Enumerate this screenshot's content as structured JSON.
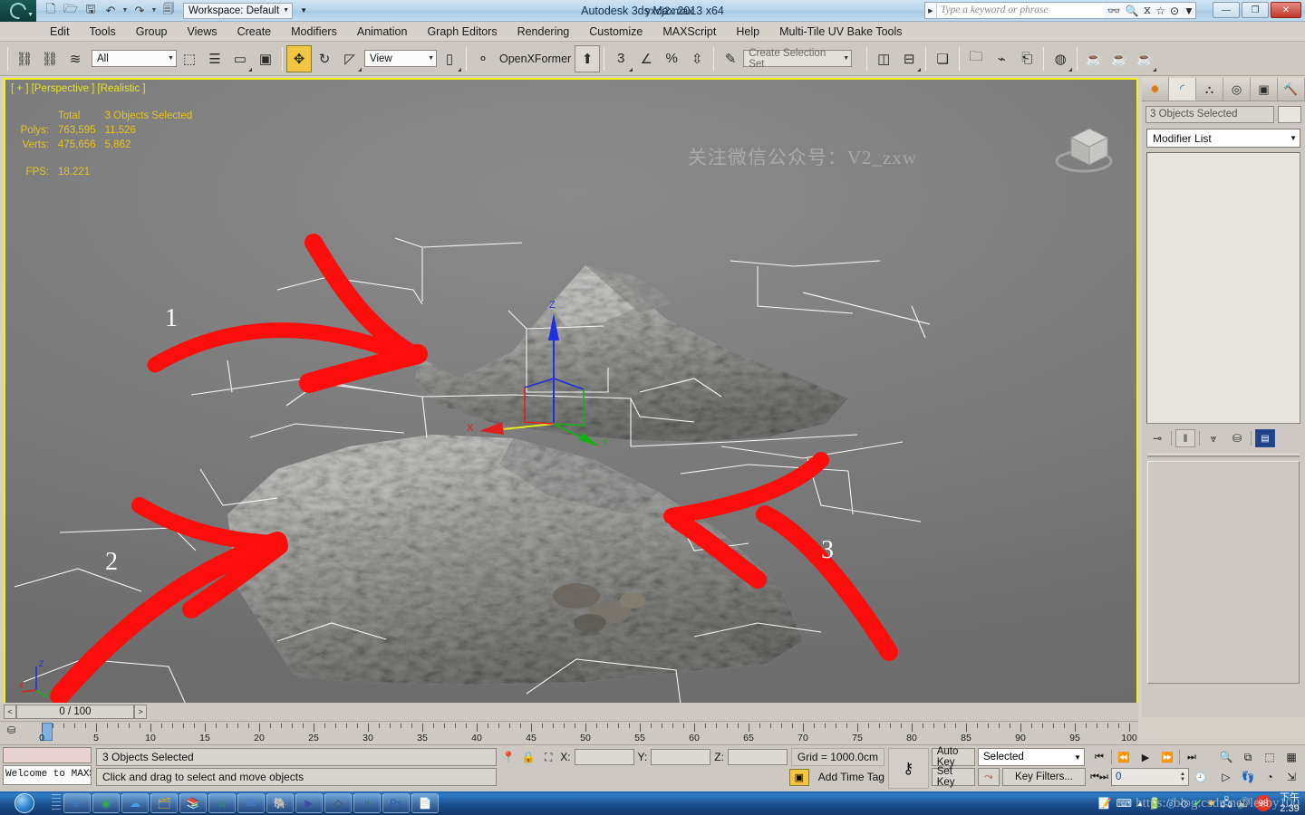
{
  "titlebar": {
    "app_title": "Autodesk 3ds Max  2013 x64",
    "file_name": "yxcj2.max",
    "workspace_label": "Workspace: Default",
    "search_placeholder": "Type a keyword or phrase",
    "quick_access": [
      {
        "name": "new-file",
        "glyph": "⬜"
      },
      {
        "name": "open-file",
        "glyph": "🗁"
      },
      {
        "name": "save-file",
        "glyph": "💾"
      },
      {
        "name": "undo",
        "glyph": "↶"
      },
      {
        "name": "redo",
        "glyph": "↷"
      },
      {
        "name": "set-project-folder",
        "glyph": "🗂"
      }
    ],
    "help_icons": [
      {
        "name": "search-binoculars",
        "glyph": "🔍"
      },
      {
        "name": "magnifier",
        "glyph": "🔎"
      },
      {
        "name": "funnel",
        "glyph": "⧖"
      },
      {
        "name": "favorite-star",
        "glyph": "☆"
      },
      {
        "name": "help",
        "glyph": "?"
      }
    ],
    "window_buttons": [
      {
        "name": "minimize",
        "glyph": "—"
      },
      {
        "name": "restore",
        "glyph": "❐"
      },
      {
        "name": "close",
        "glyph": "✕"
      }
    ]
  },
  "menubar": {
    "items": [
      "Edit",
      "Tools",
      "Group",
      "Views",
      "Create",
      "Modifiers",
      "Animation",
      "Graph Editors",
      "Rendering",
      "Customize",
      "MAXScript",
      "Help",
      "Multi-Tile UV Bake Tools"
    ]
  },
  "toolbar": {
    "select_filter_value": "All",
    "ref_coord_value": "View",
    "named_selection_placeholder": "Create Selection Set",
    "openxformer_label": "OpenXFormer",
    "groups": [
      {
        "name": "select-and-link",
        "glyph": "⚭"
      },
      {
        "name": "unlink-selection",
        "glyph": "⚬"
      },
      {
        "name": "bind-to-space-warp",
        "glyph": "≋"
      }
    ],
    "select_tools": [
      {
        "name": "select-object",
        "glyph": "❐"
      },
      {
        "name": "select-by-name",
        "glyph": "☰"
      },
      {
        "name": "rectangular-selection-region",
        "glyph": "▢"
      },
      {
        "name": "window-crossing",
        "glyph": "▣"
      }
    ],
    "transform_tools": [
      {
        "name": "select-and-move",
        "glyph": "✥",
        "active": true
      },
      {
        "name": "select-and-rotate",
        "glyph": "↺"
      },
      {
        "name": "select-and-scale",
        "glyph": "◰"
      }
    ],
    "snap_tools": [
      {
        "name": "snaps-toggle-3d",
        "glyph": "3"
      },
      {
        "name": "angle-snap-toggle",
        "glyph": "∠"
      },
      {
        "name": "percent-snap-toggle",
        "glyph": "%"
      },
      {
        "name": "spinner-snap-toggle",
        "glyph": "↕"
      },
      {
        "name": "edit-named-selection-sets",
        "glyph": "✎"
      }
    ],
    "mirror_tools": [
      {
        "name": "mirror",
        "glyph": "◧"
      },
      {
        "name": "align",
        "glyph": "≡"
      },
      {
        "name": "layer-manager",
        "glyph": "❐"
      },
      {
        "name": "toggle-scene-explorer",
        "glyph": "💡"
      },
      {
        "name": "curve-editor",
        "glyph": "∿"
      },
      {
        "name": "schematic-view",
        "glyph": "⬇"
      },
      {
        "name": "material-editor",
        "glyph": "◐"
      },
      {
        "name": "render-setup",
        "glyph": "☕"
      },
      {
        "name": "rendered-frame-window",
        "glyph": "☕"
      },
      {
        "name": "render-production",
        "glyph": "☕"
      }
    ]
  },
  "viewport": {
    "label": "[ + ] [Perspective ] [Realistic ]",
    "watermark": "关注微信公众号：V2_zxw",
    "stats": {
      "col_total": "Total",
      "col_selected": "3 Objects Selected",
      "polys_label": "Polys:",
      "polys_total": "763,595",
      "polys_selected": "11,526",
      "verts_label": "Verts:",
      "verts_total": "475,656",
      "verts_selected": "5,862",
      "fps_label": "FPS:",
      "fps_value": "18.221"
    },
    "annotations": [
      {
        "name": "annotation-1",
        "label": "1"
      },
      {
        "name": "annotation-2",
        "label": "2"
      },
      {
        "name": "annotation-3",
        "label": "3"
      }
    ],
    "gizmo_axes": [
      {
        "name": "x-axis",
        "label": "X",
        "color": "#e02020"
      },
      {
        "name": "y-axis",
        "label": "Y",
        "color": "#16b016"
      },
      {
        "name": "z-axis",
        "label": "Z",
        "color": "#2030e0"
      }
    ],
    "tripod_axes": [
      {
        "label": "X",
        "color": "#e02020"
      },
      {
        "label": "Y",
        "color": "#16b016"
      },
      {
        "label": "Z",
        "color": "#2030e0"
      }
    ],
    "border_color": "#f3f317",
    "annotation_color": "#ff0d0d"
  },
  "command_panel": {
    "tabs": [
      {
        "name": "create",
        "glyph": "☀",
        "active": false
      },
      {
        "name": "modify",
        "glyph": "◜",
        "active": true
      },
      {
        "name": "hierarchy",
        "glyph": "⛓",
        "active": false
      },
      {
        "name": "motion",
        "glyph": "◎",
        "active": false
      },
      {
        "name": "display",
        "glyph": "▣",
        "active": false
      },
      {
        "name": "utilities",
        "glyph": "🔨",
        "active": false
      }
    ],
    "object_name": "3 Objects Selected",
    "modifier_list_label": "Modifier List",
    "stack_tools": [
      {
        "name": "pin-stack",
        "glyph": "⊸"
      },
      {
        "name": "show-end-result",
        "glyph": "‖"
      },
      {
        "name": "make-unique",
        "glyph": "⍰"
      },
      {
        "name": "remove-modifier",
        "glyph": "♻"
      },
      {
        "name": "configure-modifier-sets",
        "glyph": "☰"
      }
    ]
  },
  "time_slider": {
    "prev_frame": "<",
    "next_frame": ">",
    "current": "0 / 100",
    "ruler_start": 0,
    "ruler_end": 100,
    "ruler_step": 5,
    "labels": [
      0,
      5,
      10,
      15,
      20,
      25,
      30,
      35,
      40,
      45,
      50,
      55,
      60,
      65,
      70,
      75,
      80,
      85,
      90,
      95,
      100
    ]
  },
  "status_bar": {
    "maxscript_listener": "Welcome to MAXScript.",
    "selection_status": "3 Objects Selected",
    "prompt": "Click and drag to select and move objects",
    "coord_labels": {
      "x": "X:",
      "y": "Y:",
      "z": "Z:"
    },
    "coord_values": {
      "x": "",
      "y": "",
      "z": ""
    },
    "grid_label": "Grid = 1000.0cm",
    "add_time_tag": "Add Time Tag",
    "lock_icons": [
      {
        "name": "selection-lock-pin",
        "glyph": "📍"
      },
      {
        "name": "selection-lock-toggle",
        "glyph": "🔒"
      },
      {
        "name": "absolute-relative-toggle",
        "glyph": "❐"
      }
    ],
    "auto_key_label": "Auto Key",
    "set_key_label": "Set Key",
    "key_mode_value": "Selected",
    "key_filters_label": "Key Filters...",
    "key_icon": "⚷",
    "current_frame_value": "0",
    "playback_buttons": [
      {
        "name": "go-to-start",
        "glyph": "⏮"
      },
      {
        "name": "previous-frame",
        "glyph": "⏪"
      },
      {
        "name": "play-animation",
        "glyph": "▶"
      },
      {
        "name": "next-frame",
        "glyph": "⏩"
      },
      {
        "name": "go-to-end",
        "glyph": "⏭"
      }
    ],
    "nav_buttons": [
      {
        "name": "zoom",
        "glyph": "🔍"
      },
      {
        "name": "zoom-extents",
        "glyph": "⧉"
      },
      {
        "name": "zoom-region",
        "glyph": "❐"
      },
      {
        "name": "zoom-all",
        "glyph": "▦"
      },
      {
        "name": "pan-view",
        "glyph": "✋"
      },
      {
        "name": "orbit",
        "glyph": "⚡"
      },
      {
        "name": "field-of-view",
        "glyph": "◔"
      },
      {
        "name": "maximize-viewport-toggle",
        "glyph": "↖"
      }
    ]
  },
  "taskbar": {
    "start_label": "Start",
    "apps": [
      {
        "name": "internet-explorer",
        "glyph": "e",
        "color": "#2f7fd0"
      },
      {
        "name": "google-chrome",
        "glyph": "◉",
        "color": "#34a853"
      },
      {
        "name": "cloud-app",
        "glyph": "☁",
        "color": "#4a9de0"
      },
      {
        "name": "file-explorer",
        "glyph": "🗂",
        "color": "#e0a820"
      },
      {
        "name": "winrar",
        "glyph": "📚",
        "color": "#c03a2b"
      },
      {
        "name": "qq-music",
        "glyph": "♫",
        "color": "#1aa34a"
      },
      {
        "name": "foxmail",
        "glyph": "✉",
        "color": "#4a7fd0"
      },
      {
        "name": "evernote",
        "glyph": "🐘",
        "color": "#2d8c6e"
      },
      {
        "name": "media-player",
        "glyph": "▶",
        "color": "#3b4fa8"
      },
      {
        "name": "unity",
        "glyph": "◇",
        "color": "#4a4a4a"
      },
      {
        "name": "3ds-max",
        "glyph": "ͧ",
        "color": "#2b6f6a"
      },
      {
        "name": "photoshop",
        "glyph": "Ps",
        "color": "#2a5fa8"
      },
      {
        "name": "notepad",
        "glyph": "📄",
        "color": "#9fb8cc"
      }
    ],
    "tray": [
      {
        "name": "tray-notes",
        "glyph": "📝"
      },
      {
        "name": "tray-keyboard",
        "glyph": "⌨"
      },
      {
        "name": "tray-show-hidden",
        "glyph": "▲"
      },
      {
        "name": "tray-usb",
        "glyph": "🔋"
      },
      {
        "name": "tray-360-security",
        "glyph": "◎"
      },
      {
        "name": "tray-unity-hub",
        "glyph": "◇"
      },
      {
        "name": "tray-driver",
        "glyph": "✔"
      },
      {
        "name": "tray-shield",
        "glyph": "✺"
      },
      {
        "name": "tray-network",
        "glyph": "🖧"
      },
      {
        "name": "tray-volume",
        "glyph": "🔊"
      },
      {
        "name": "tray-badge",
        "glyph": "98"
      }
    ],
    "clock_time": "2:39",
    "clock_date": "下午",
    "watermark": "https://blog.csdn.net/leeby100"
  }
}
